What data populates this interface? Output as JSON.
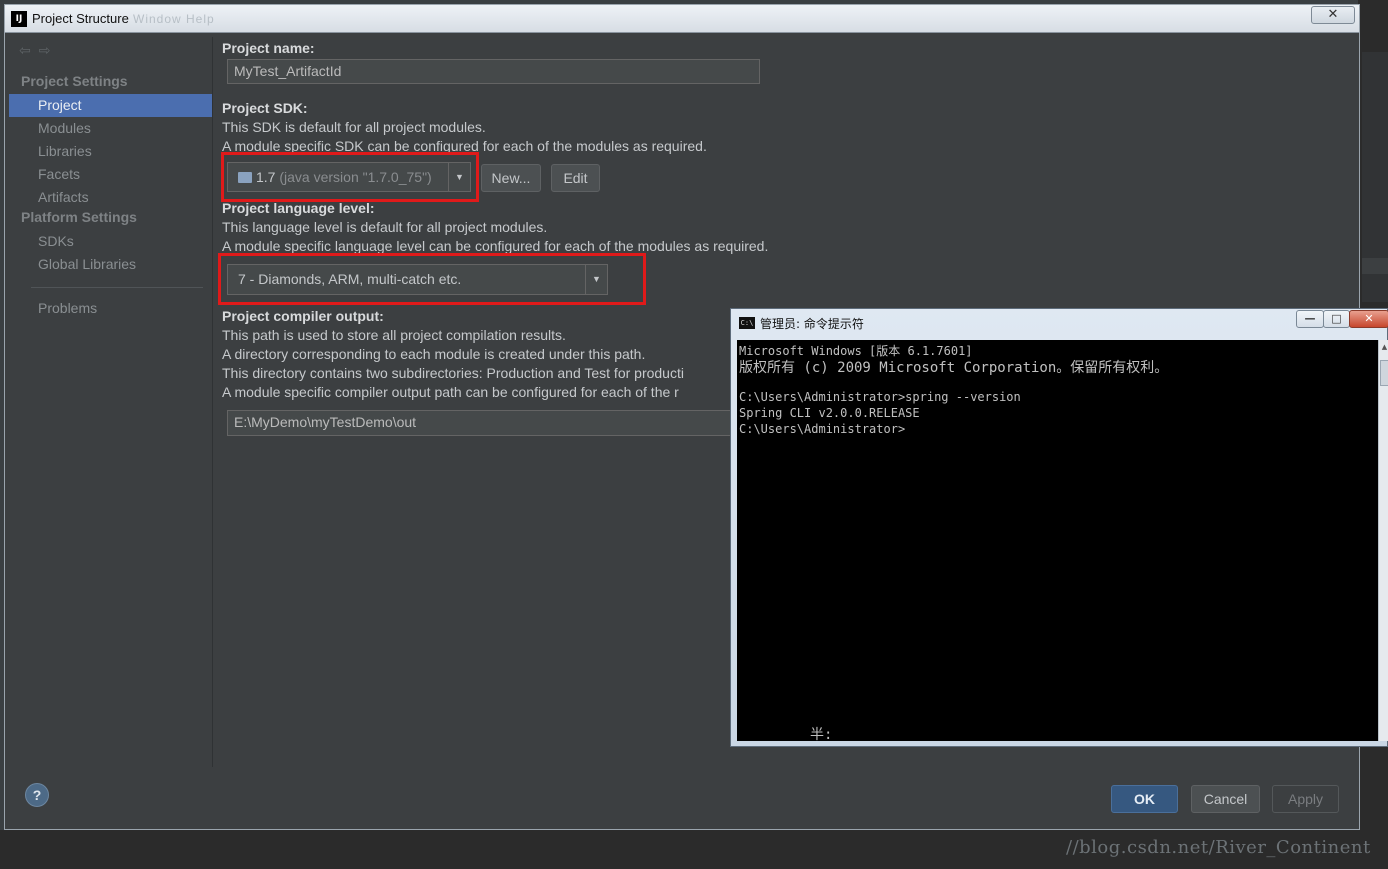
{
  "window": {
    "title": "Project Structure",
    "title_ghost": "Window  Help",
    "app_icon": "IJ",
    "close_glyph": "✕"
  },
  "sidebar": {
    "project_settings_header": "Project Settings",
    "platform_settings_header": "Platform Settings",
    "items": [
      {
        "label": "Project",
        "selected": true
      },
      {
        "label": "Modules"
      },
      {
        "label": "Libraries"
      },
      {
        "label": "Facets"
      },
      {
        "label": "Artifacts"
      },
      {
        "label": "SDKs"
      },
      {
        "label": "Global Libraries"
      },
      {
        "label": "Problems"
      }
    ]
  },
  "project": {
    "name_label": "Project name:",
    "name_value": "MyTest_ArtifactId",
    "sdk_label": "Project SDK:",
    "sdk_desc1": "This SDK is default for all project modules.",
    "sdk_desc2": "A module specific SDK can be configured for each of the modules as required.",
    "sdk_value": "1.7",
    "sdk_detail": "(java version \"1.7.0_75\")",
    "new_button": "New...",
    "edit_button": "Edit",
    "lang_label": "Project language level:",
    "lang_desc1": "This language level is default for all project modules.",
    "lang_desc2": "A module specific language level can be configured for each of the modules as required.",
    "lang_value": "7 - Diamonds, ARM, multi-catch etc.",
    "output_label": "Project compiler output:",
    "output_desc1": "This path is used to store all project compilation results.",
    "output_desc2": "A directory corresponding to each module is created under this path.",
    "output_desc3": "This directory contains two subdirectories: Production and Test for producti",
    "output_desc4": "A module specific compiler output path can be configured for each of the r",
    "output_value": "E:\\MyDemo\\myTestDemo\\out"
  },
  "buttons": {
    "help": "?",
    "ok": "OK",
    "cancel": "Cancel",
    "apply": "Apply"
  },
  "cmd": {
    "title": "管理员: 命令提示符",
    "icon": "C:\\",
    "lines": [
      "Microsoft Windows [版本 6.1.7601]",
      "版权所有 (c) 2009 Microsoft Corporation。保留所有权利。",
      "",
      "C:\\Users\\Administrator>spring --version",
      "Spring CLI v2.0.0.RELEASE",
      "C:\\Users\\Administrator>"
    ],
    "ime_status": "半:"
  },
  "watermark": "//blog.csdn.net/River_Continent",
  "colors": {
    "selection": "#4b6eaf",
    "highlight_box": "#e01a1a",
    "ok_button": "#365880"
  }
}
